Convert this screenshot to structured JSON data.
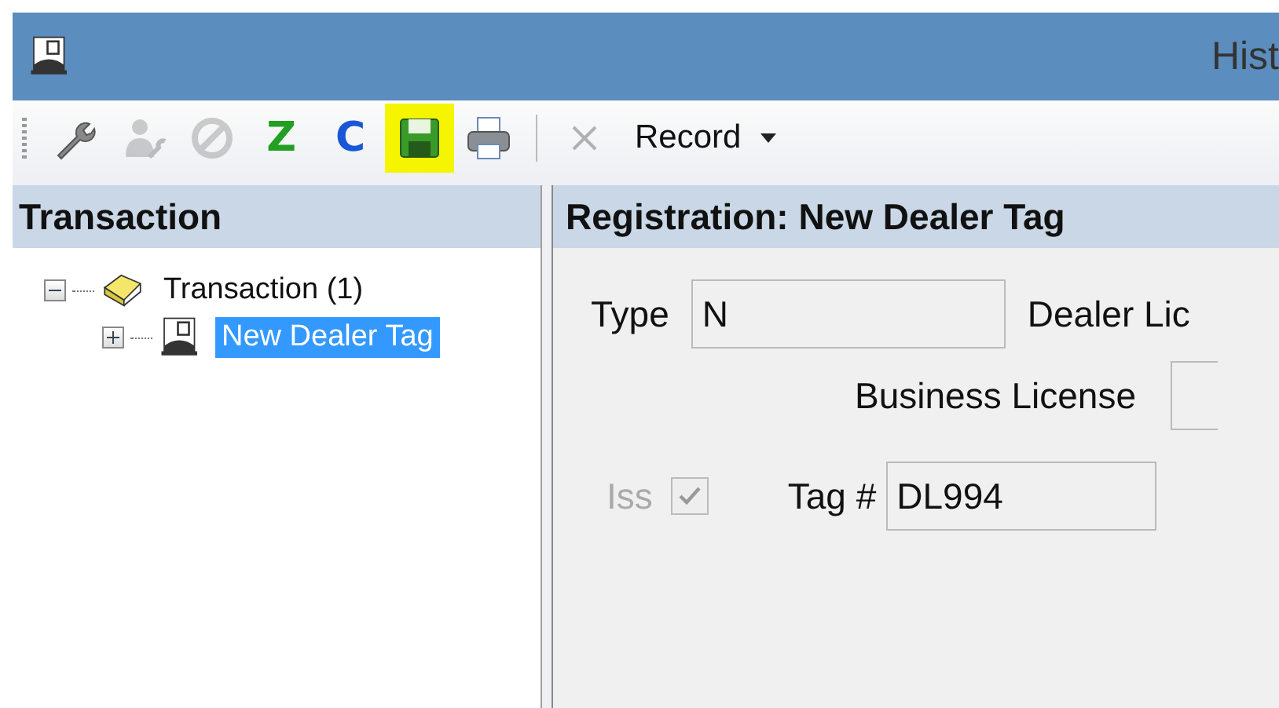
{
  "window": {
    "title": "Hist"
  },
  "toolbar": [
    {
      "kind": "wrench",
      "disabled": false,
      "highlighted": false
    },
    {
      "kind": "user-wrench",
      "disabled": true,
      "highlighted": false
    },
    {
      "kind": "no-entry",
      "disabled": true,
      "highlighted": false
    },
    {
      "kind": "letter",
      "text": "Z",
      "color": "#22a022",
      "disabled": false,
      "highlighted": false
    },
    {
      "kind": "letter",
      "text": "C",
      "color": "#1a56d8",
      "disabled": false,
      "highlighted": false
    },
    {
      "kind": "save",
      "disabled": false,
      "highlighted": true
    },
    {
      "kind": "print",
      "disabled": false,
      "highlighted": false
    },
    {
      "kind": "separator"
    },
    {
      "kind": "close",
      "disabled": true,
      "highlighted": false
    },
    {
      "kind": "dropdown",
      "text": "Record",
      "disabled": false,
      "highlighted": false
    }
  ],
  "sidebar": {
    "title": "Transaction",
    "tree": [
      {
        "label": "Transaction (1)",
        "kind": "folder",
        "expanded": true,
        "selected": false,
        "children": [
          {
            "label": "New Dealer Tag",
            "kind": "registration",
            "expanded": false,
            "selected": true
          }
        ]
      }
    ]
  },
  "panel": {
    "title": "Registration: New Dealer Tag",
    "type": {
      "label": "Type",
      "value": "N"
    },
    "dealer_license": {
      "label": "Dealer Lic"
    },
    "business_license": {
      "label": "Business License"
    },
    "iss": {
      "label": "Iss",
      "checked": true,
      "disabled": true
    },
    "tag": {
      "label": "Tag #",
      "value": "DL994"
    }
  }
}
